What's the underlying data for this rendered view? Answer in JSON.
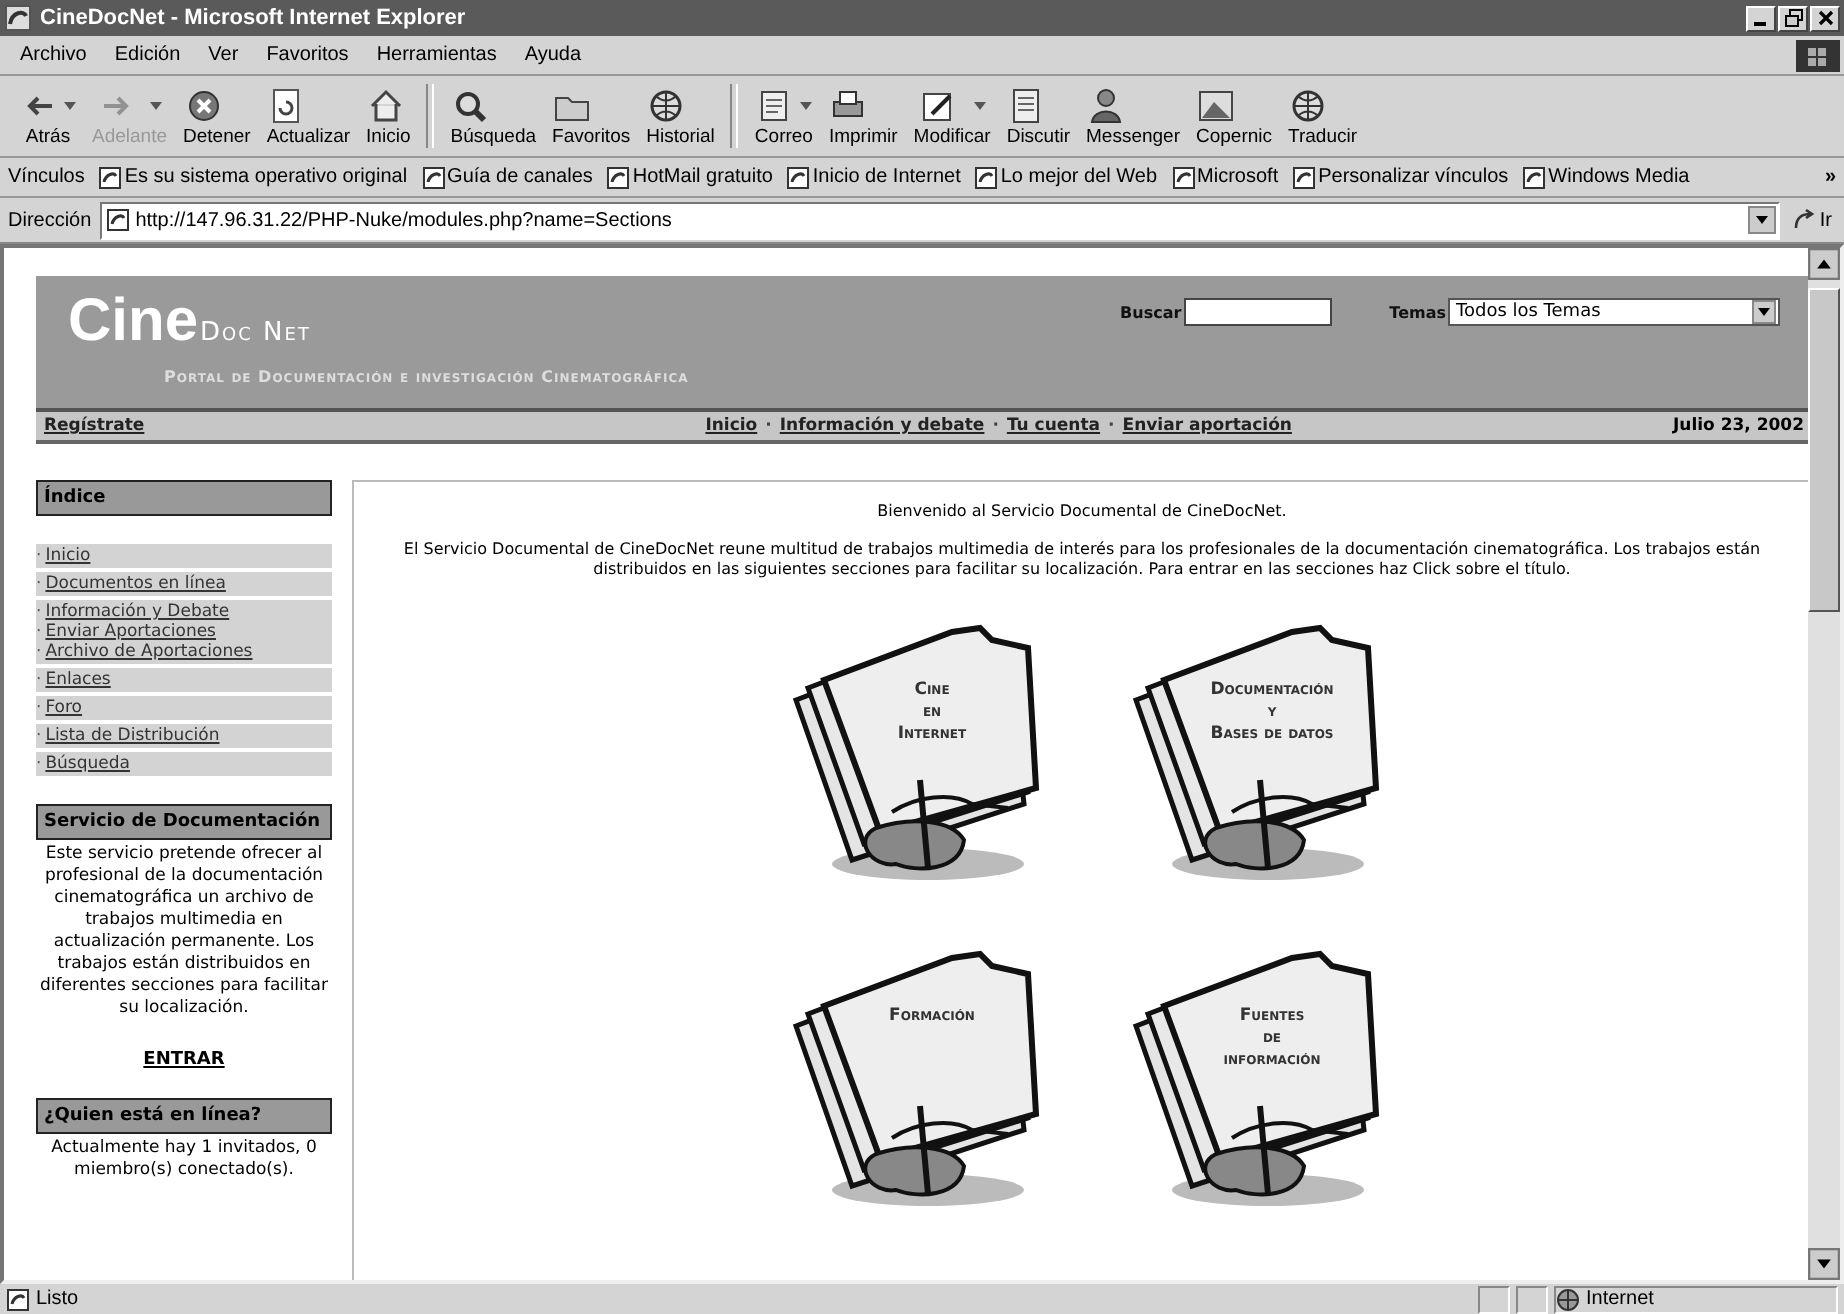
{
  "window": {
    "title": "CineDocNet - Microsoft Internet Explorer"
  },
  "menu": [
    "Archivo",
    "Edición",
    "Ver",
    "Favoritos",
    "Herramientas",
    "Ayuda"
  ],
  "toolbar": [
    {
      "label": "Atrás",
      "dropdown": true,
      "disabled": false
    },
    {
      "label": "Adelante",
      "dropdown": true,
      "disabled": true
    },
    {
      "label": "Detener",
      "dropdown": false,
      "disabled": false
    },
    {
      "label": "Actualizar",
      "dropdown": false,
      "disabled": false
    },
    {
      "label": "Inicio",
      "dropdown": false,
      "disabled": false
    },
    {
      "label": "Búsqueda",
      "dropdown": false,
      "disabled": false
    },
    {
      "label": "Favoritos",
      "dropdown": false,
      "disabled": false
    },
    {
      "label": "Historial",
      "dropdown": false,
      "disabled": false
    },
    {
      "label": "Correo",
      "dropdown": true,
      "disabled": false
    },
    {
      "label": "Imprimir",
      "dropdown": false,
      "disabled": false
    },
    {
      "label": "Modificar",
      "dropdown": true,
      "disabled": false
    },
    {
      "label": "Discutir",
      "dropdown": false,
      "disabled": false
    },
    {
      "label": "Messenger",
      "dropdown": false,
      "disabled": false
    },
    {
      "label": "Copernic",
      "dropdown": false,
      "disabled": false
    },
    {
      "label": "Traducir",
      "dropdown": false,
      "disabled": false
    }
  ],
  "links_bar": {
    "label": "Vínculos",
    "items": [
      "Es su sistema operativo original",
      "Guía de canales",
      "HotMail gratuito",
      "Inicio de Internet",
      "Lo mejor del Web",
      "Microsoft",
      "Personalizar vínculos",
      "Windows Media"
    ],
    "more": "»"
  },
  "address_bar": {
    "label": "Dirección",
    "value": "http://147.96.31.22/PHP-Nuke/modules.php?name=Sections",
    "go": "Ir"
  },
  "page": {
    "header": {
      "logo_main": "Cine",
      "logo_sub": "Doc Net",
      "tagline": "Portal de Documentación e investigación Cinematográfica",
      "search_label": "Buscar",
      "topics_label": "Temas",
      "topics_value": "Todos los Temas"
    },
    "nav": {
      "left": "Regístrate",
      "items": [
        {
          "kind": "link",
          "text": "Inicio"
        },
        {
          "kind": "separator",
          "text": "·"
        },
        {
          "kind": "link",
          "text": "Información y debate"
        },
        {
          "kind": "separator",
          "text": "·"
        },
        {
          "kind": "link",
          "text": "Tu cuenta"
        },
        {
          "kind": "separator",
          "text": "·"
        },
        {
          "kind": "link",
          "text": "Enviar aportación"
        }
      ],
      "date": "Julio 23, 2002"
    },
    "sidebar": {
      "index_title": "Índice",
      "groups": [
        {
          "items": [
            {
              "bullet": "·",
              "text": "Inicio"
            }
          ]
        },
        {
          "items": [
            {
              "bullet": "·",
              "text": "Documentos en línea"
            }
          ]
        },
        {
          "items": [
            {
              "bullet": "·",
              "text": "Información y Debate"
            },
            {
              "bullet": "·",
              "text": "Enviar Aportaciones"
            },
            {
              "bullet": "·",
              "text": "Archivo de Aportaciones"
            }
          ]
        },
        {
          "items": [
            {
              "bullet": "·",
              "text": "Enlaces"
            }
          ]
        },
        {
          "items": [
            {
              "bullet": "·",
              "text": "Foro"
            }
          ]
        },
        {
          "items": [
            {
              "bullet": "·",
              "text": "Lista de Distribución"
            }
          ]
        },
        {
          "items": [
            {
              "bullet": "·",
              "text": "Búsqueda"
            }
          ]
        }
      ],
      "service_title": "Servicio de Documentación",
      "service_text": "Este servicio pretende ofrecer al profesional de la documentación cinematográfica un archivo de trabajos multimedia en actualización permanente. Los trabajos están distribuidos en diferentes secciones para facilitar su localización.",
      "service_link": "ENTRAR",
      "online_title": "¿Quien está en línea?",
      "online_text": "Actualmente hay 1 invitados, 0 miembro(s) conectado(s)."
    },
    "content": {
      "welcome": "Bienvenido al Servicio Documental de CineDocNet.",
      "intro": "El Servicio Documental de CineDocNet reune multitud de trabajos multimedia de interés para los profesionales de la documentación cinematográfica. Los trabajos están distribuidos en las siguientes secciones para facilitar su localización. Para entrar en las secciones haz Click sobre el título.",
      "sections": [
        {
          "lines": [
            "Cine",
            "en",
            "Internet"
          ]
        },
        {
          "lines": [
            "Documentación",
            "y",
            "Bases de datos"
          ]
        },
        {
          "lines": [
            "Formación"
          ]
        },
        {
          "lines": [
            "Fuentes",
            "de",
            "información"
          ]
        }
      ]
    }
  },
  "status_bar": {
    "text": "Listo",
    "zone": "Internet"
  }
}
